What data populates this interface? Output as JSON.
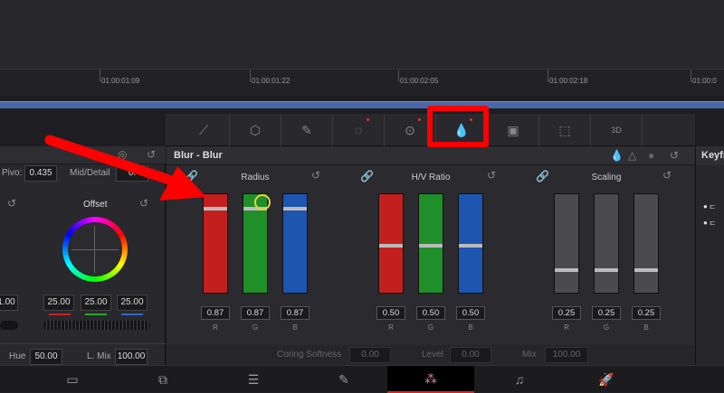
{
  "timeline": {
    "timecodes": [
      "01:00:01:09",
      "01:00:01:22",
      "01:00:02:05",
      "01:00:02:18",
      "01:00:0"
    ]
  },
  "toolbar": {
    "tools": [
      {
        "icon": "curves-icon",
        "glyph": "⟋"
      },
      {
        "icon": "color-warper-icon",
        "glyph": "⬡"
      },
      {
        "icon": "qualifier-icon",
        "glyph": "✎"
      },
      {
        "icon": "window-icon",
        "glyph": "◌"
      },
      {
        "icon": "tracker-icon",
        "glyph": "⊙"
      },
      {
        "icon": "blur-icon",
        "glyph": "💧"
      },
      {
        "icon": "key-icon",
        "glyph": "▣"
      },
      {
        "icon": "sizing-icon",
        "glyph": "⬚"
      },
      {
        "icon": "3d-icon",
        "glyph": "3D"
      }
    ]
  },
  "left": {
    "pivot_label": "Pivo:",
    "pivot": "0.435",
    "mid_label": "Mid/Detail",
    "mid": "0.",
    "offset_title": "Offset",
    "values": [
      "1.00",
      "25.00",
      "25.00",
      "25.00"
    ],
    "hue_label": "Hue",
    "hue": "50.00",
    "lmix_label": "L. Mix",
    "lmix": "100.00"
  },
  "blur": {
    "title": "Blur - Blur",
    "groups": [
      {
        "title": "Radius",
        "values": [
          "0.87",
          "0.87",
          "0.87"
        ],
        "level": 0.87
      },
      {
        "title": "H/V Ratio",
        "values": [
          "0.50",
          "0.50",
          "0.50"
        ],
        "level": 0.5
      },
      {
        "title": "Scaling",
        "values": [
          "0.25",
          "0.25",
          "0.25"
        ],
        "level": 0.25
      }
    ],
    "channels": [
      "R",
      "G",
      "B"
    ],
    "coring_label": "Coring Softness",
    "coring": "0.00",
    "level_label": "Level",
    "level": "0.00",
    "mix_label": "Mix",
    "mix": "100.00"
  },
  "right": {
    "title": "Keyfr"
  },
  "colors": {
    "red": "#c41f1f",
    "green": "#1f8f2a",
    "blue": "#1d55b0",
    "annotation": "#ff0000"
  }
}
